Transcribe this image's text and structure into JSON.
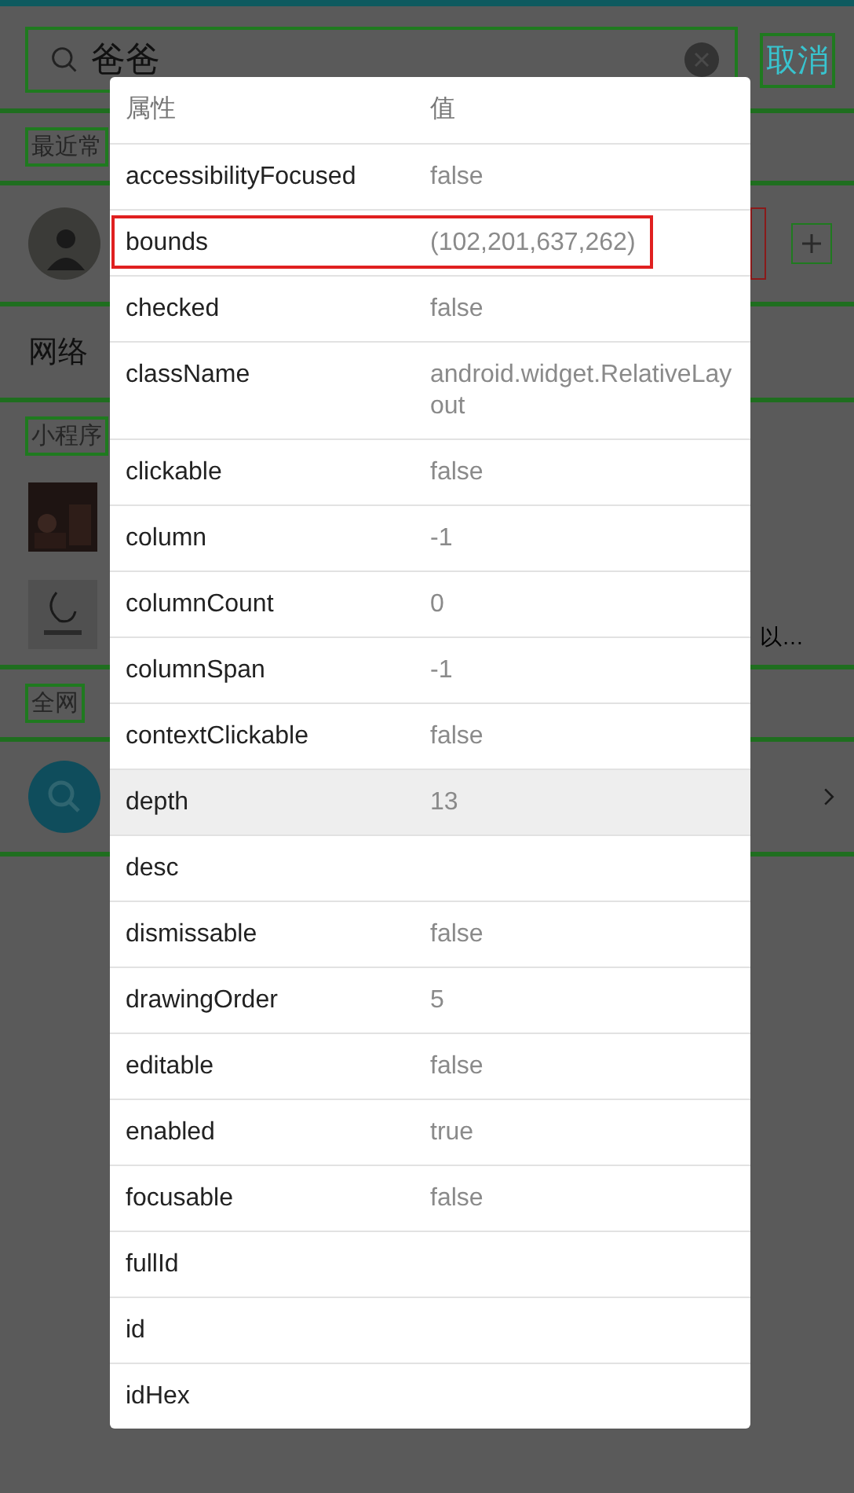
{
  "search": {
    "value": "爸爸",
    "cancel": "取消"
  },
  "background": {
    "recent_label": "最近常",
    "network_label": "网络",
    "mini_label": "小程序",
    "mini_snippet": "以…",
    "web_label": "全网"
  },
  "dialog": {
    "header": {
      "key": "属性",
      "value": "值"
    },
    "rows": [
      {
        "key": "accessibilityFocused",
        "value": "false",
        "selected": false,
        "outlined": false
      },
      {
        "key": "bounds",
        "value": "(102,201,637,262)",
        "selected": false,
        "outlined": true
      },
      {
        "key": "checked",
        "value": "false",
        "selected": false,
        "outlined": false
      },
      {
        "key": "className",
        "value": "android.widget.RelativeLayout",
        "selected": false,
        "outlined": false
      },
      {
        "key": "clickable",
        "value": "false",
        "selected": false,
        "outlined": false
      },
      {
        "key": "column",
        "value": "-1",
        "selected": false,
        "outlined": false
      },
      {
        "key": "columnCount",
        "value": "0",
        "selected": false,
        "outlined": false
      },
      {
        "key": "columnSpan",
        "value": "-1",
        "selected": false,
        "outlined": false
      },
      {
        "key": "contextClickable",
        "value": "false",
        "selected": false,
        "outlined": false
      },
      {
        "key": "depth",
        "value": "13",
        "selected": true,
        "outlined": false
      },
      {
        "key": "desc",
        "selected": false,
        "outlined": false
      },
      {
        "key": "dismissable",
        "value": "false",
        "selected": false,
        "outlined": false
      },
      {
        "key": "drawingOrder",
        "value": "5",
        "selected": false,
        "outlined": false
      },
      {
        "key": "editable",
        "value": "false",
        "selected": false,
        "outlined": false
      },
      {
        "key": "enabled",
        "value": "true",
        "selected": false,
        "outlined": false
      },
      {
        "key": "focusable",
        "value": "false",
        "selected": false,
        "outlined": false
      },
      {
        "key": "fullId",
        "selected": false,
        "outlined": false
      },
      {
        "key": "id",
        "selected": false,
        "outlined": false
      },
      {
        "key": "idHex",
        "selected": false,
        "outlined": false
      }
    ]
  }
}
